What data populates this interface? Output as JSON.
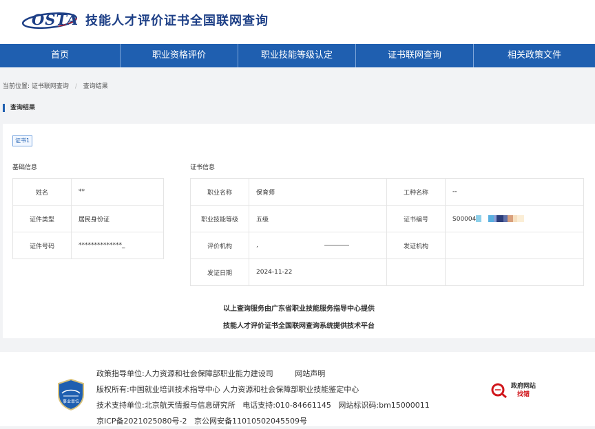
{
  "header": {
    "logo_text": "OSTA",
    "title": "技能人才评价证书全国联网查询"
  },
  "nav": {
    "items": [
      "首页",
      "职业资格评价",
      "职业技能等级认定",
      "证书联网查询",
      "相关政策文件"
    ]
  },
  "breadcrumb": {
    "prefix": "当前位置:",
    "items": [
      "证书联网查询",
      "查询结果"
    ],
    "separator": "/"
  },
  "section_title": "查询结果",
  "result": {
    "cert_tab": "证书1",
    "basic_title": "基础信息",
    "cert_title": "证书信息",
    "basic": [
      {
        "label": "姓名",
        "value": "**"
      },
      {
        "label": "证件类型",
        "value": "居民身份证"
      },
      {
        "label": "证件号码",
        "value": "**************_"
      }
    ],
    "cert": [
      {
        "label": "职业名称",
        "value": "保育师",
        "label2": "工种名称",
        "value2": "--"
      },
      {
        "label": "职业技能等级",
        "value": "五级",
        "label2": "证书编号",
        "value2": "S00004"
      },
      {
        "label": "评价机构",
        "value": ",",
        "label2": "发证机构",
        "value2": ""
      },
      {
        "label": "发证日期",
        "value": "2024-11-22"
      }
    ],
    "credit_lines": [
      "以上查询服务由广东省职业技能服务指导中心提供",
      "技能人才评价证书全国联网查询系统提供技术平台"
    ]
  },
  "footer": {
    "guide_unit": "政策指导单位:人力资源和社会保障部职业能力建设司",
    "statement_link": "网站声明",
    "copyright": "版权所有:中国就业培训技术指导中心  人力资源和社会保障部职业技能鉴定中心",
    "tech_support": "技术支持单位:北京航天情报与信息研究所",
    "phone": "电话支持:010-84661145",
    "site_id": "网站标识码:bm15000011",
    "icp": "京ICP备2021025080号-2",
    "police": "京公网安备11010502045509号",
    "badge_text": "事业单位",
    "gov_line1": "政府网站",
    "gov_line2": "找错"
  },
  "colors": {
    "brand_blue": "#1f5fb0",
    "dark_blue": "#1d3f86",
    "red": "#d0161b"
  }
}
